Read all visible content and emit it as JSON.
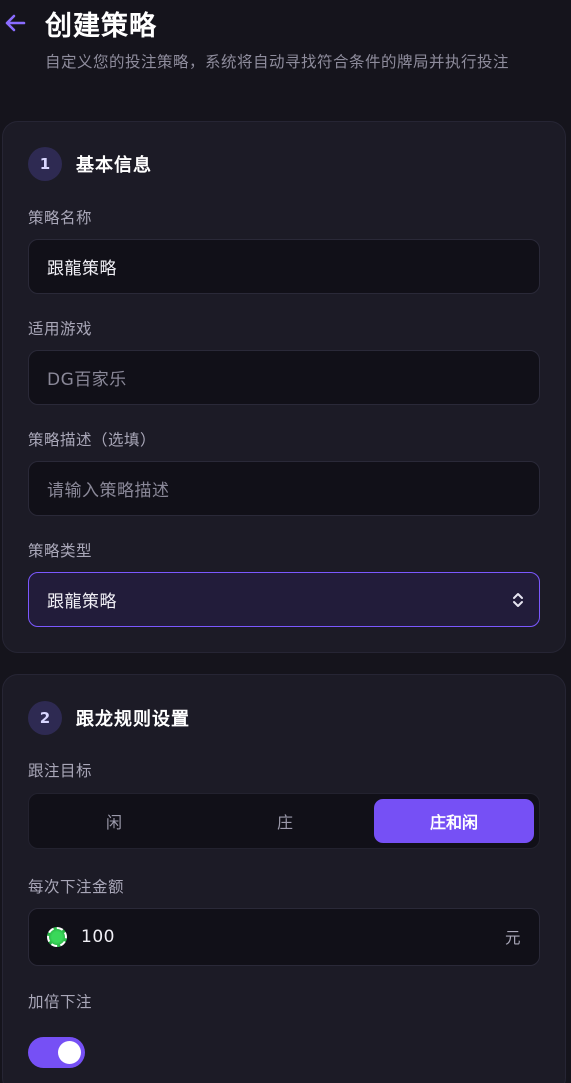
{
  "header": {
    "title": "创建策略",
    "subtitle": "自定义您的投注策略，系统将自动寻找符合条件的牌局并执行投注"
  },
  "section1": {
    "number": "1",
    "title": "基本信息",
    "name_label": "策略名称",
    "name_value": "跟龍策略",
    "game_label": "适用游戏",
    "game_value": "DG百家乐",
    "desc_label": "策略描述（选填）",
    "desc_placeholder": "请输入策略描述",
    "type_label": "策略类型",
    "type_value": "跟龍策略"
  },
  "section2": {
    "number": "2",
    "title": "跟龙规则设置",
    "target_label": "跟注目标",
    "target_options": [
      "闲",
      "庄",
      "庄和闲"
    ],
    "target_selected": "庄和闲",
    "amount_label": "每次下注金额",
    "amount_value": "100",
    "amount_unit": "元",
    "double_label": "加倍下注",
    "double_enabled": true
  },
  "colors": {
    "accent": "#7650f5",
    "background": "#15141c",
    "card": "#1c1b26"
  },
  "icons": {
    "back": "arrow-left-icon",
    "select": "chevron-updown-icon",
    "coin": "chip-icon"
  }
}
